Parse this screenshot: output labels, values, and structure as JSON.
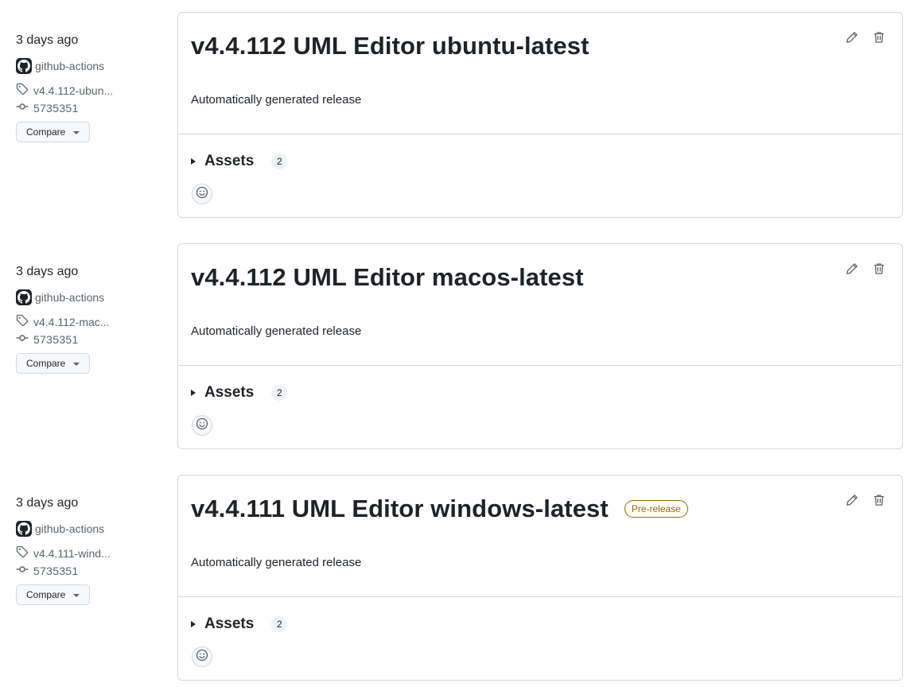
{
  "releases": [
    {
      "date": "3 days ago",
      "author": "github-actions",
      "tag": "v4.4.112-ubun...",
      "commit": "5735351",
      "compare_label": "Compare",
      "title": "v4.4.112 UML Editor ubuntu-latest",
      "badge": "",
      "body": "Automatically generated release",
      "assets_label": "Assets",
      "assets_count": "2"
    },
    {
      "date": "3 days ago",
      "author": "github-actions",
      "tag": "v4.4.112-mac...",
      "commit": "5735351",
      "compare_label": "Compare",
      "title": "v4.4.112 UML Editor macos-latest",
      "badge": "",
      "body": "Automatically generated release",
      "assets_label": "Assets",
      "assets_count": "2"
    },
    {
      "date": "3 days ago",
      "author": "github-actions",
      "tag": "v4.4.111-wind...",
      "commit": "5735351",
      "compare_label": "Compare",
      "title": "v4.4.111 UML Editor windows-latest",
      "badge": "Pre-release",
      "body": "Automatically generated release",
      "assets_label": "Assets",
      "assets_count": "2"
    }
  ],
  "icons": {
    "avatar": "github-mark-icon",
    "tag": "tag-icon",
    "commit": "git-commit-icon",
    "edit": "pencil-icon",
    "delete": "trash-icon",
    "reaction": "smiley-icon"
  },
  "colors": {
    "prerelease": "#9a6700",
    "border": "#d1d9e0",
    "text": "#1f2328",
    "muted": "#59636e"
  }
}
